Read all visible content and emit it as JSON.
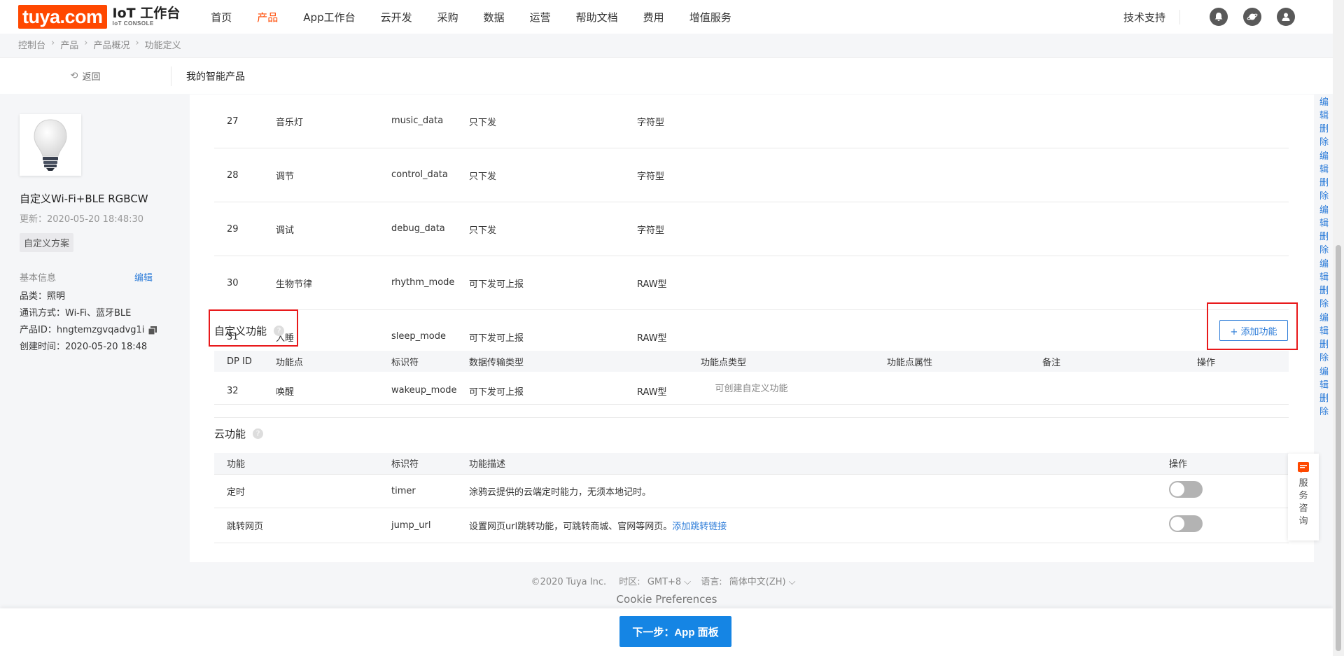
{
  "nav": {
    "logo": "tuya.com",
    "console_title": "IoT 工作台",
    "console_sub": "IoT CONSOLE",
    "items": [
      {
        "label": "首页"
      },
      {
        "label": "产品"
      },
      {
        "label": "App工作台"
      },
      {
        "label": "云开发"
      },
      {
        "label": "采购"
      },
      {
        "label": "数据"
      },
      {
        "label": "运营"
      },
      {
        "label": "帮助文档"
      },
      {
        "label": "费用"
      },
      {
        "label": "增值服务"
      }
    ],
    "active_index": 1,
    "support": "技术支持",
    "icons": [
      "bell-icon",
      "planet-icon",
      "user-avatar-icon"
    ]
  },
  "breadcrumb": [
    "控制台",
    "产品",
    "产品概况",
    "功能定义"
  ],
  "subheader": {
    "back": "返回",
    "title": "我的智能产品"
  },
  "product": {
    "name": "自定义Wi-Fi+BLE RGBCW",
    "updated": "更新：2020-05-20 18:48:30",
    "tag": "自定义方案",
    "basic_info_label": "基本信息",
    "edit_label": "编辑",
    "category": "品类：照明",
    "protocol": "通讯方式：Wi-Fi、蓝牙BLE",
    "product_id": "产品ID：hngtemzgvqadvg1i",
    "created": "创建时间：2020-05-20 18:48"
  },
  "standard_rows": [
    {
      "id": "27",
      "name": "音乐灯",
      "code": "music_data",
      "mode": "只下发",
      "type": "字符型"
    },
    {
      "id": "28",
      "name": "调节",
      "code": "control_data",
      "mode": "只下发",
      "type": "字符型"
    },
    {
      "id": "29",
      "name": "调试",
      "code": "debug_data",
      "mode": "只下发",
      "type": "字符型"
    },
    {
      "id": "30",
      "name": "生物节律",
      "code": "rhythm_mode",
      "mode": "可下发可上报",
      "type": "RAW型"
    },
    {
      "id": "31",
      "name": "入睡",
      "code": "sleep_mode",
      "mode": "可下发可上报",
      "type": "RAW型"
    },
    {
      "id": "32",
      "name": "唤醒",
      "code": "wakeup_mode",
      "mode": "可下发可上报",
      "type": "RAW型"
    }
  ],
  "ops": {
    "edit": "编辑",
    "delete": "删除"
  },
  "custom": {
    "title": "自定义功能",
    "add_button": "+ 添加功能",
    "columns": [
      "DP ID",
      "功能点",
      "标识符",
      "数据传输类型",
      "功能点类型",
      "功能点属性",
      "备注",
      "操作"
    ],
    "empty": "可创建自定义功能"
  },
  "cloud": {
    "title": "云功能",
    "columns": [
      "功能",
      "标识符",
      "功能描述",
      "操作"
    ],
    "rows": [
      {
        "name": "定时",
        "code": "timer",
        "desc": "涂鸦云提供的云端定时能力，无须本地记时。",
        "link": "",
        "enabled": false
      },
      {
        "name": "跳转网页",
        "code": "jump_url",
        "desc": "设置网页url跳转功能，可跳转商城、官网等网页。",
        "link": "添加跳转链接",
        "enabled": false
      }
    ]
  },
  "footer": {
    "copyright": "©2020 Tuya Inc.",
    "timezone_label": "时区:",
    "timezone": "GMT+8",
    "lang_label": "语言:",
    "lang": "简体中文(ZH)",
    "cookie": "Cookie Preferences"
  },
  "next_button": "下一步：App 面板",
  "service": "服务咨询"
}
